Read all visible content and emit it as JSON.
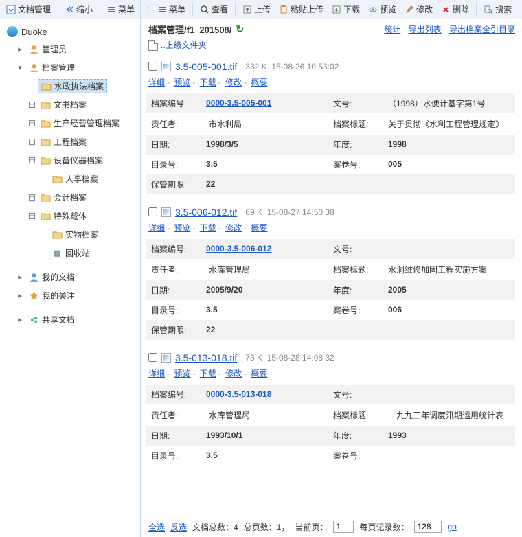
{
  "sidebar_toolbar": {
    "doc_mgmt": "文档管理",
    "shrink": "缩小",
    "menu": "菜单"
  },
  "main_toolbar": {
    "menu": "菜单",
    "view": "查看",
    "upload": "上传",
    "paste_upload": "粘贴上传",
    "download": "下载",
    "preview": "预览",
    "edit": "修改",
    "delete": "删除",
    "search": "搜索"
  },
  "org": "Duoke",
  "tree": {
    "admin": "管理员",
    "doc_mgmt": "档案管理",
    "items": [
      {
        "label": "水政执法档案",
        "selected": true,
        "plus": false
      },
      {
        "label": "文书档案",
        "plus": true
      },
      {
        "label": "生产经营管理档案",
        "plus": true
      },
      {
        "label": "工程档案",
        "plus": true
      },
      {
        "label": "设备仪器档案",
        "plus": true
      },
      {
        "label": "人事档案",
        "plus": false,
        "indent": true
      },
      {
        "label": "会计档案",
        "plus": true
      },
      {
        "label": "特殊载体",
        "plus": true
      },
      {
        "label": "实物档案",
        "plus": false,
        "indent": true
      },
      {
        "label": "回收站",
        "plus": false,
        "indent": true,
        "trash": true
      }
    ],
    "my_docs": "我的文档",
    "my_follow": "我的关注",
    "shared": "共享文档"
  },
  "path": {
    "text": "档案管理/f1_201508/",
    "stats": "统计",
    "export_list": "导出列表",
    "export_full": "导出档案全引目录"
  },
  "uplink": "..上级文件夹",
  "action_labels": {
    "detail": "详细",
    "preview": "预览",
    "download": "下载",
    "edit": "修改",
    "overview": "概要"
  },
  "field_labels": {
    "archive_no": "档案编号:",
    "doc_no": "文号:",
    "owner": "责任者:",
    "title": "档案标题:",
    "date": "日期:",
    "year": "年度:",
    "cat_no": "目录号:",
    "vol_no": "案卷号:",
    "retention": "保管期限:"
  },
  "records": [
    {
      "file": "3.5-005-001.tif",
      "size": "332 K",
      "time": "15-08-26 10:53:02",
      "archive_no": "0000-3.5-005-001",
      "doc_no": "（1998）水便计基字第1号",
      "owner": "市水利局",
      "title": "关于贯彻《水利工程管理规定》",
      "date": "1998/3/5",
      "year": "1998",
      "cat": "3.5",
      "vol": "005",
      "ret": "22"
    },
    {
      "file": "3.5-006-012.tif",
      "size": "69 K",
      "time": "15-08-27 14:50:38",
      "archive_no": "0000-3.5-006-012",
      "doc_no": "",
      "owner": "水库管理局",
      "title": "水洞维修加固工程实施方案",
      "date": "2005/9/20",
      "year": "2005",
      "cat": "3.5",
      "vol": "006",
      "ret": "22"
    },
    {
      "file": "3.5-013-018.tif",
      "size": "73 K",
      "time": "15-08-28 14:08:32",
      "archive_no": "0000-3.5-013-018",
      "doc_no": "",
      "owner": "水库管理局",
      "title": "一九九三年调度汛期运用统计表",
      "date": "1993/10/1",
      "year": "1993",
      "cat": "3.5",
      "vol": "",
      "ret": ""
    }
  ],
  "pager": {
    "select_all": "全选",
    "invert": "反选",
    "doc_total_lbl": "文档总数：",
    "doc_total": "4",
    "pages_lbl": "总页数：",
    "pages": "1，",
    "cur_lbl": "当前页：",
    "cur": "1",
    "per_lbl": "每页记录数：",
    "per": "128",
    "go": "go"
  }
}
